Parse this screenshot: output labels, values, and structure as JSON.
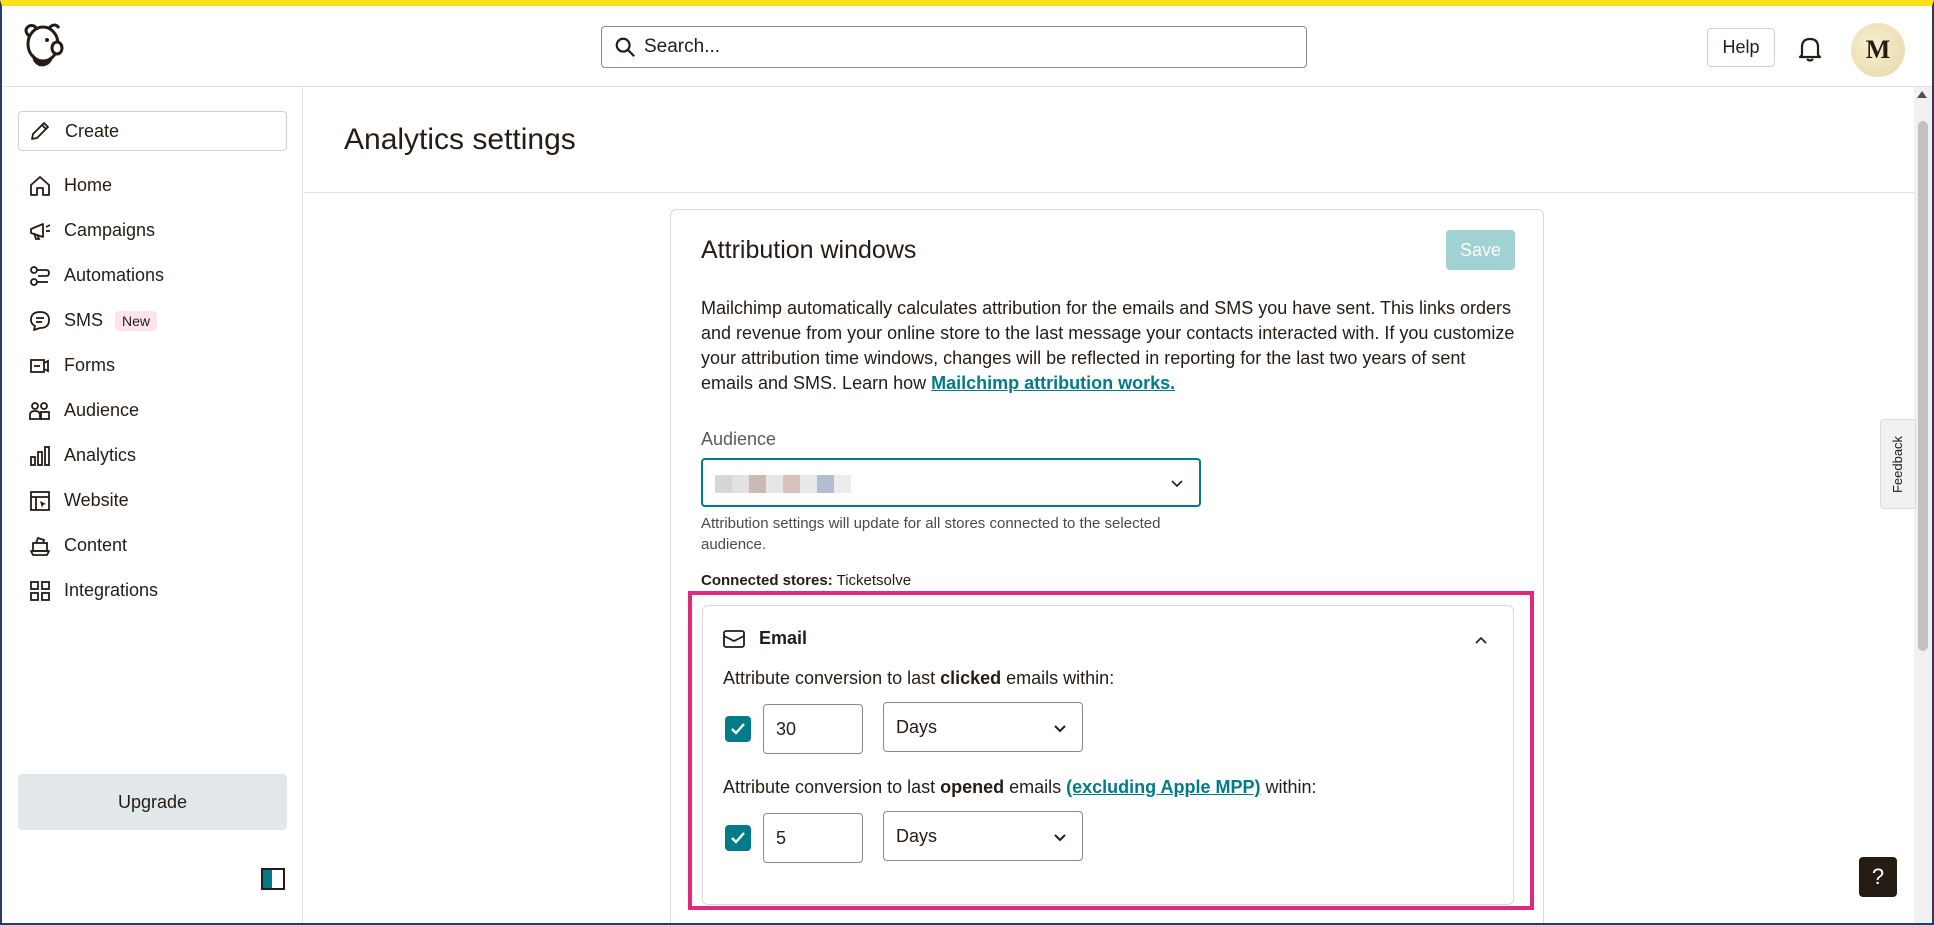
{
  "topbar": {
    "search_placeholder": "Search...",
    "help_label": "Help",
    "avatar_initial": "M"
  },
  "sidebar": {
    "create_label": "Create",
    "items": [
      {
        "label": "Home",
        "icon": "home-icon"
      },
      {
        "label": "Campaigns",
        "icon": "megaphone-icon"
      },
      {
        "label": "Automations",
        "icon": "automation-icon"
      },
      {
        "label": "SMS",
        "icon": "sms-icon",
        "badge": "New"
      },
      {
        "label": "Forms",
        "icon": "forms-icon"
      },
      {
        "label": "Audience",
        "icon": "audience-icon"
      },
      {
        "label": "Analytics",
        "icon": "analytics-icon"
      },
      {
        "label": "Website",
        "icon": "website-icon"
      },
      {
        "label": "Content",
        "icon": "content-icon"
      },
      {
        "label": "Integrations",
        "icon": "integrations-icon"
      }
    ],
    "upgrade_label": "Upgrade"
  },
  "page": {
    "title": "Analytics settings"
  },
  "card": {
    "title": "Attribution windows",
    "save_label": "Save",
    "description": "Mailchimp automatically calculates attribution for the emails and SMS you have sent. This links orders and revenue from your online store to the last message your contacts interacted with. If you customize your attribution time windows, changes will be reflected in reporting for the last two years of sent emails and SMS. Learn how ",
    "description_link": "Mailchimp attribution works.",
    "audience_label": "Audience",
    "audience_help": "Attribution settings will update for all stores connected to the selected audience.",
    "stores_label": "Connected stores:",
    "stores_value": " Ticketsolve"
  },
  "email": {
    "title": "Email",
    "clicked": {
      "prefix": "Attribute conversion to last ",
      "emphasis": "clicked",
      "suffix": " emails within:",
      "checked": true,
      "value": "30",
      "unit": "Days"
    },
    "opened": {
      "prefix": "Attribute conversion to last ",
      "emphasis": "opened",
      "middle": " emails ",
      "link": "(excluding Apple MPP)",
      "suffix": " within:",
      "checked": true,
      "value": "5",
      "unit": "Days"
    }
  },
  "feedback_label": "Feedback",
  "help_fab_label": "?",
  "colors": {
    "accent": "#007c89",
    "brand_yellow": "#ffe01b",
    "highlight": "#e0297f",
    "save_disabled": "#a0d1d3"
  }
}
